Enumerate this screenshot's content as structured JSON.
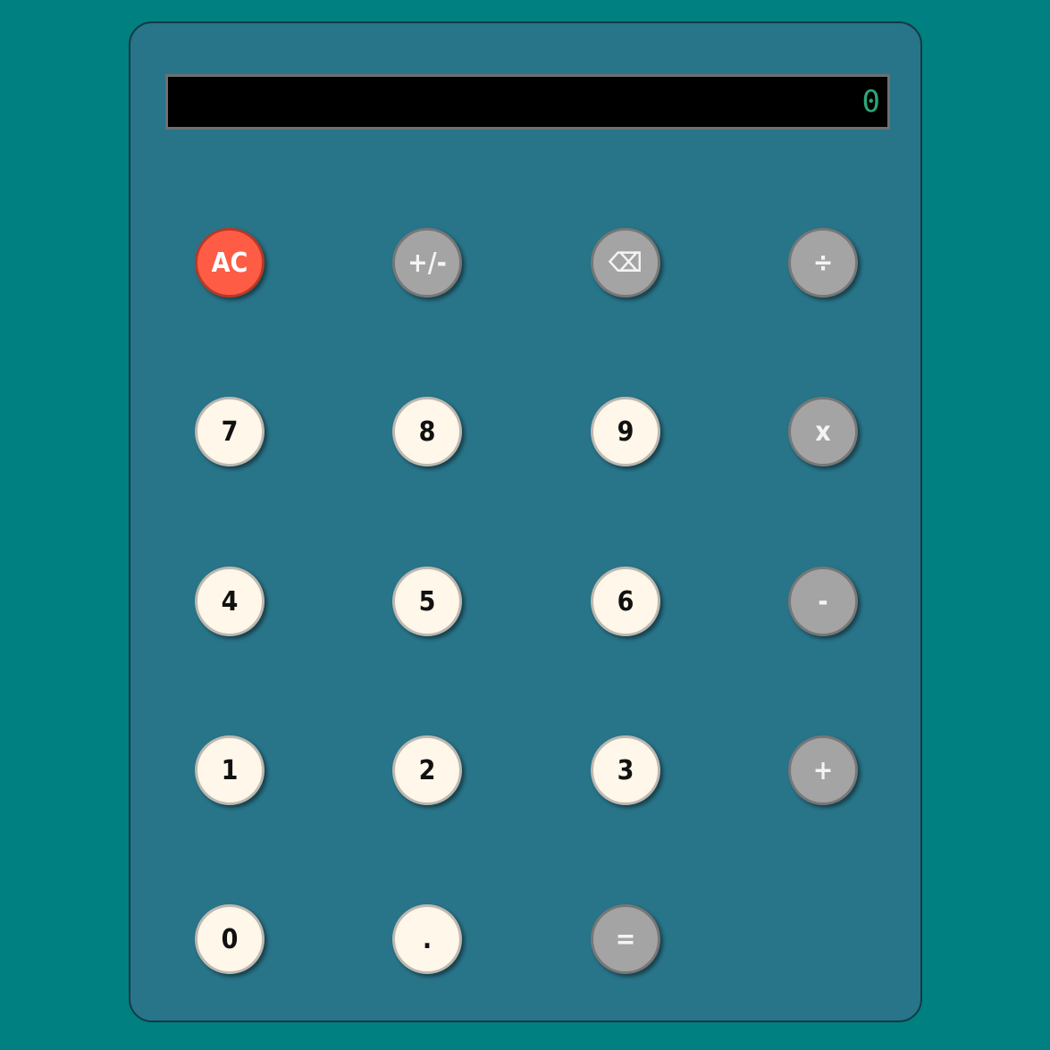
{
  "display": {
    "value": "0"
  },
  "colors": {
    "background": "#008080",
    "body": "#287489",
    "display_bg": "#000000",
    "display_text": "#2aa878",
    "digit_key": "#fff7e9",
    "operator_key": "#a4a4a4",
    "clear_key": "#ff5c45"
  },
  "keys": {
    "clear": "AC",
    "sign": "+/-",
    "backspace": "⌫",
    "divide": "÷",
    "multiply": "x",
    "subtract": "-",
    "add": "+",
    "equals": "=",
    "decimal": ".",
    "d0": "0",
    "d1": "1",
    "d2": "2",
    "d3": "3",
    "d4": "4",
    "d5": "5",
    "d6": "6",
    "d7": "7",
    "d8": "8",
    "d9": "9"
  }
}
